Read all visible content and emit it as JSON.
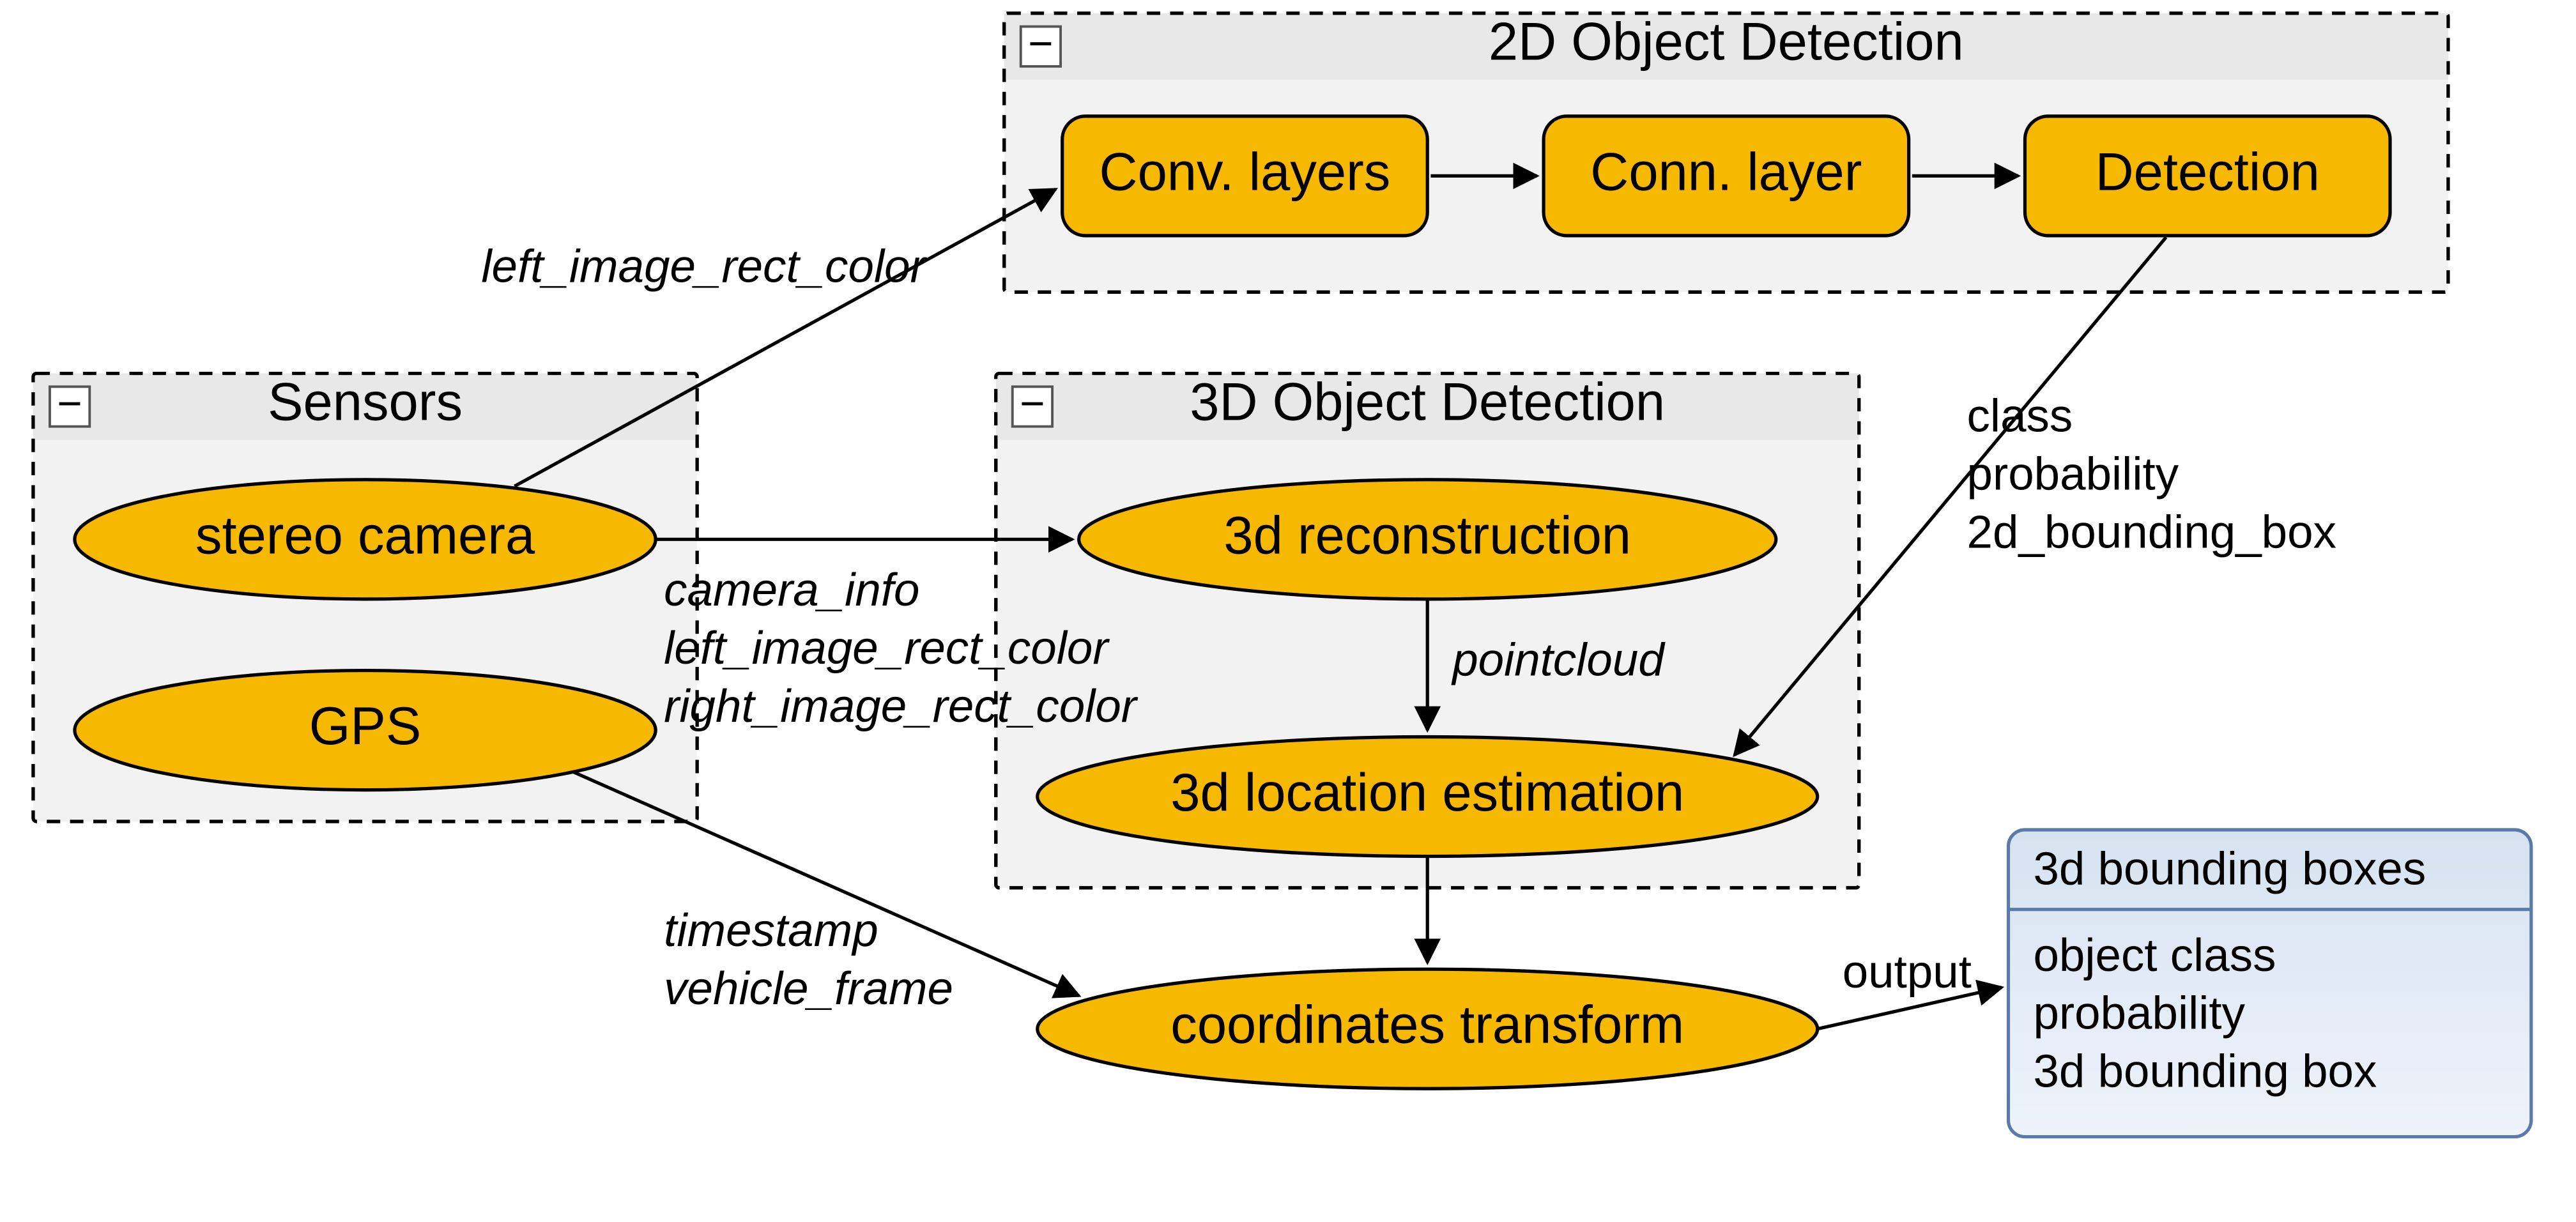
{
  "groups": {
    "sensors": {
      "title": "Sensors"
    },
    "det2d": {
      "title": "2D Object Detection"
    },
    "det3d": {
      "title": "3D Object Detection"
    }
  },
  "nodes": {
    "stereo_camera": "stereo camera",
    "gps": "GPS",
    "conv_layers": "Conv. layers",
    "conn_layer": "Conn. layer",
    "detection": "Detection",
    "recon3d": "3d reconstruction",
    "locest3d": "3d location estimation",
    "coord_xform": "coordinates transform"
  },
  "edges": {
    "cam_to_2d": "left_image_rect_color",
    "cam_to_3d_l1": "camera_info",
    "cam_to_3d_l2": "left_image_rect_color",
    "cam_to_3d_l3": "right_image_rect_color",
    "recon_to_loc": "pointcloud",
    "det_to_loc_l1": "class",
    "det_to_loc_l2": "probability",
    "det_to_loc_l3": "2d_bounding_box",
    "gps_to_xform_l1": "timestamp",
    "gps_to_xform_l2": "vehicle_frame",
    "xform_to_out": "output"
  },
  "output_box": {
    "title": "3d bounding boxes",
    "line1": "object class",
    "line2": "probability",
    "line3": "3d bounding box"
  },
  "icons": {
    "collapse": "−"
  }
}
